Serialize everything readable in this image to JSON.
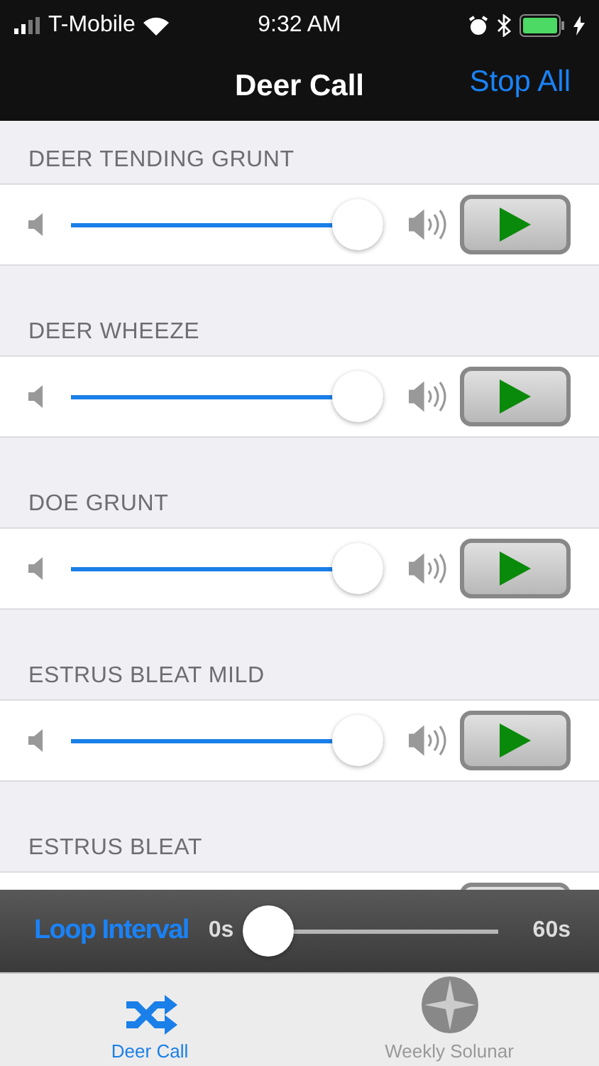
{
  "status_bar": {
    "carrier": "T-Mobile",
    "time": "9:32 AM"
  },
  "nav": {
    "title": "Deer Call",
    "action": "Stop All"
  },
  "calls": [
    {
      "name": "DEER TENDING GRUNT",
      "level": 0.92
    },
    {
      "name": "DEER WHEEZE",
      "level": 0.92
    },
    {
      "name": "DOE GRUNT",
      "level": 0.92
    },
    {
      "name": "ESTRUS BLEAT MILD",
      "level": 0.92
    },
    {
      "name": "ESTRUS BLEAT"
    }
  ],
  "loop": {
    "label": "Loop Interval",
    "min": "0s",
    "max": "60s",
    "level": 0
  },
  "tabs": [
    {
      "label": "Deer Call",
      "selected": true,
      "kind": "shuffle"
    },
    {
      "label": "Weekly Solunar",
      "selected": false,
      "kind": "compass"
    }
  ]
}
